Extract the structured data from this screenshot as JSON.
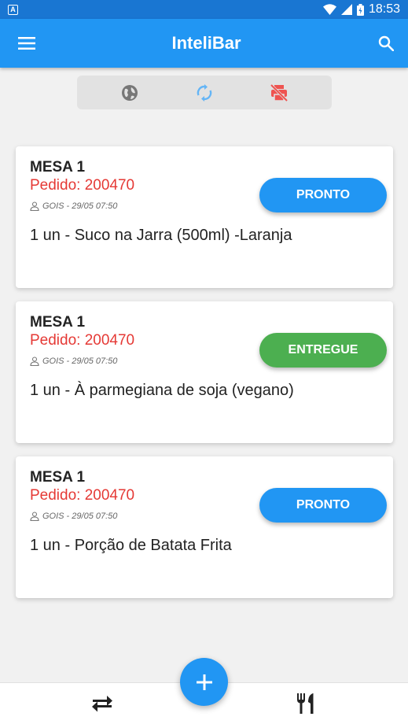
{
  "status_bar": {
    "app_icon_letter": "A",
    "time": "18:53"
  },
  "appbar": {
    "title": "InteliBar",
    "menu_icon": "menu-icon",
    "search_icon": "search-icon"
  },
  "filters": [
    {
      "icon": "globe-icon"
    },
    {
      "icon": "sync-icon"
    },
    {
      "icon": "print-disabled-icon"
    }
  ],
  "orders": [
    {
      "mesa": "MESA 1",
      "pedido": "Pedido: 200470",
      "meta": "GOIS - 29/05 07:50",
      "item": "1 un - Suco na Jarra (500ml) -Laranja",
      "status": "PRONTO",
      "status_color": "#2196f3"
    },
    {
      "mesa": "MESA 1",
      "pedido": "Pedido: 200470",
      "meta": "GOIS - 29/05 07:50",
      "item": "1 un - À parmegiana de soja (vegano)",
      "status": "ENTREGUE",
      "status_color": "#4caf50"
    },
    {
      "mesa": "MESA 1",
      "pedido": "Pedido: 200470",
      "meta": "GOIS - 29/05 07:50",
      "item": "1 un - Porção de Batata Frita",
      "status": "PRONTO",
      "status_color": "#2196f3"
    }
  ],
  "bottom_nav": {
    "left_icon": "swap-icon",
    "right_icon": "restaurant-icon",
    "fab_icon": "add-icon"
  },
  "colors": {
    "primary": "#2196f3",
    "status_bar": "#1976d2",
    "pedido_red": "#e53935",
    "entregue_green": "#4caf50"
  }
}
